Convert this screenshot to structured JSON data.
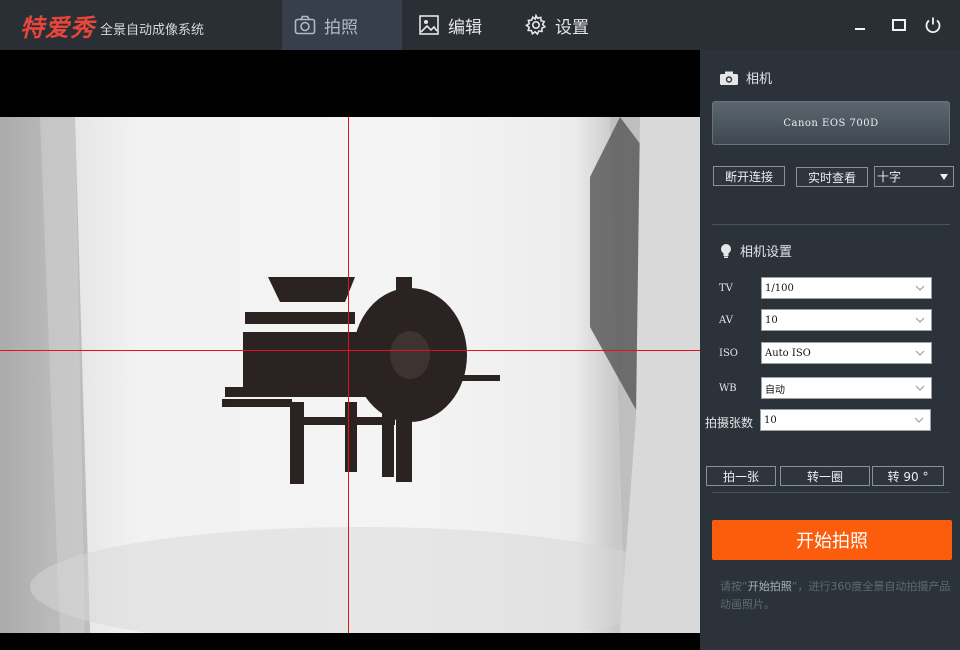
{
  "app": {
    "logo": "特爱秀",
    "subtitle": "全景自动成像系统"
  },
  "tabs": [
    {
      "label": "拍照",
      "icon": "camera-icon",
      "active": true
    },
    {
      "label": "编辑",
      "icon": "image-icon",
      "active": false
    },
    {
      "label": "设置",
      "icon": "gear-icon",
      "active": false
    }
  ],
  "window_controls": [
    "minimize-icon",
    "maximize-icon",
    "power-icon"
  ],
  "panel": {
    "camera_section": {
      "title": "相机",
      "camera_name": "Canon EOS 700D",
      "disconnect_label": "断开连接",
      "live_view_label": "实时查看",
      "overlay_mode": "十字"
    },
    "settings_section": {
      "title": "相机设置",
      "rows": [
        {
          "label": "TV",
          "value": "1/100"
        },
        {
          "label": "AV",
          "value": "10"
        },
        {
          "label": "ISO",
          "value": "Auto ISO"
        },
        {
          "label": "WB",
          "value": "自动"
        },
        {
          "label": "拍摄张数",
          "value": "10"
        }
      ]
    },
    "actions": {
      "shoot_one": "拍一张",
      "rotate_full": "转一圈",
      "rotate_90": "转 90 °"
    },
    "start_label": "开始拍照",
    "hint": {
      "before": "请按“",
      "highlight": "开始拍照",
      "after": "”，进行360度全景自动拍摄产品动画照片。"
    }
  },
  "colors": {
    "accent": "#fb5d0d",
    "crosshair": "#e0141a",
    "logo": "#e8463a"
  }
}
